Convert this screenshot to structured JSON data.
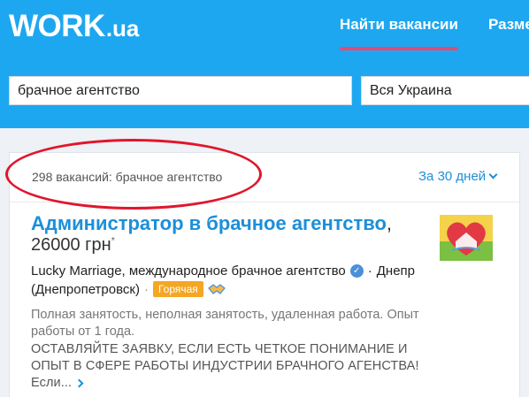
{
  "header": {
    "logo_main": "WORK",
    "logo_suffix": ".ua",
    "nav_find": "Найти вакансии",
    "nav_post": "Разме"
  },
  "search": {
    "query": "брачное агентство",
    "region": "Вся Украина"
  },
  "results": {
    "count_text": "298 вакансий: брачное агентство",
    "period": "За 30 дней"
  },
  "job": {
    "title": "Администратор в брачное агентство",
    "title_comma": ",",
    "salary": "26000 грн",
    "salary_mark": "*",
    "company": "Lucky Marriage, международное брачное агентство",
    "city_prefix": "Днепр",
    "city": "(Днепропетровск)",
    "separator": "·",
    "badge": "Горячая",
    "description": "Полная занятость, неполная занятость, удаленная работа. Опыт работы от 1 года.",
    "caps_text": "ОСТАВЛЯЙТЕ ЗАЯВКУ, ЕСЛИ ЕСТЬ ЧЕТКОЕ ПОНИМАНИЕ И ОПЫТ В СФЕРЕ РАБОТЫ ИНДУСТРИИ БРАЧНОГО АГЕНСТВА! Если..."
  },
  "colors": {
    "header_bg": "#1da7f0",
    "nav_underline": "#e84a72",
    "link": "#1c8fd9",
    "badge": "#f5a623",
    "annotation": "#e0162b"
  }
}
